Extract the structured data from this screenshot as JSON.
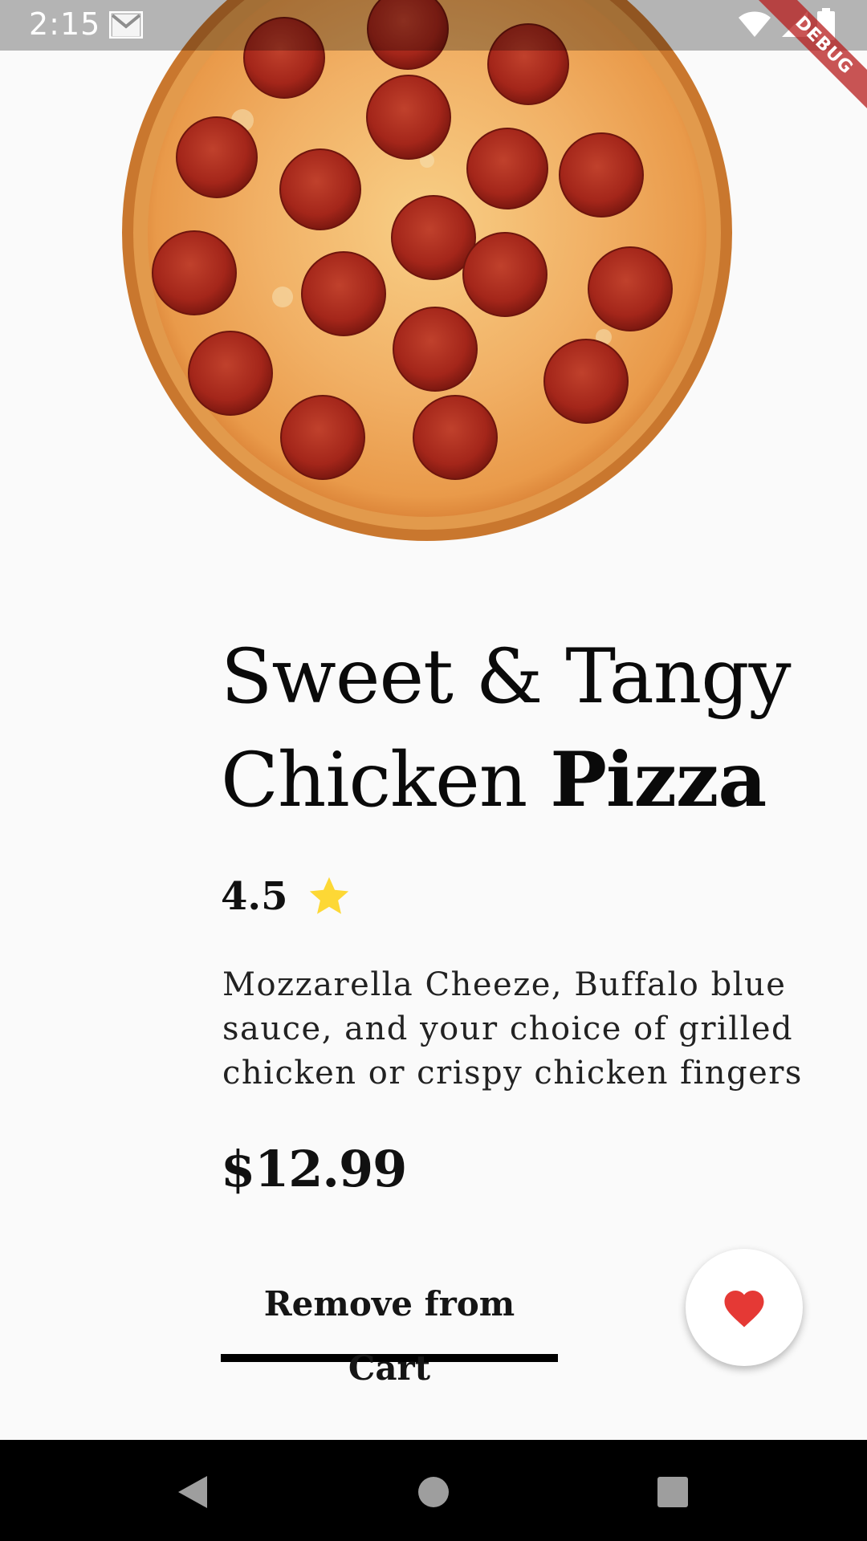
{
  "status_bar": {
    "time": "2:15",
    "notification_icons": [
      "gmail-icon"
    ],
    "system_icons": [
      "wifi-icon",
      "cell-signal-icon",
      "battery-icon"
    ]
  },
  "debug_banner": {
    "label": "DEBUG",
    "color": "#b71c1c"
  },
  "product": {
    "image_icon": "pepperoni-pizza",
    "title_regular": "Sweet & Tangy Chicken ",
    "title_bold": "Pizza",
    "rating": "4.5",
    "rating_icon": "star-icon",
    "description": "Mozzarella Cheeze, Buffalo blue sauce, and your choice of grilled chicken or crispy chicken fingers",
    "price": "$12.99"
  },
  "actions": {
    "cart_label": "Remove from Cart",
    "favorite_icon": "heart-icon"
  },
  "nav_bar": {
    "buttons": [
      "back-icon",
      "home-icon",
      "recents-icon"
    ]
  },
  "colors": {
    "background": "#fafafa",
    "star": "#fdd835",
    "heart": "#e53935",
    "underline": "#000000"
  }
}
